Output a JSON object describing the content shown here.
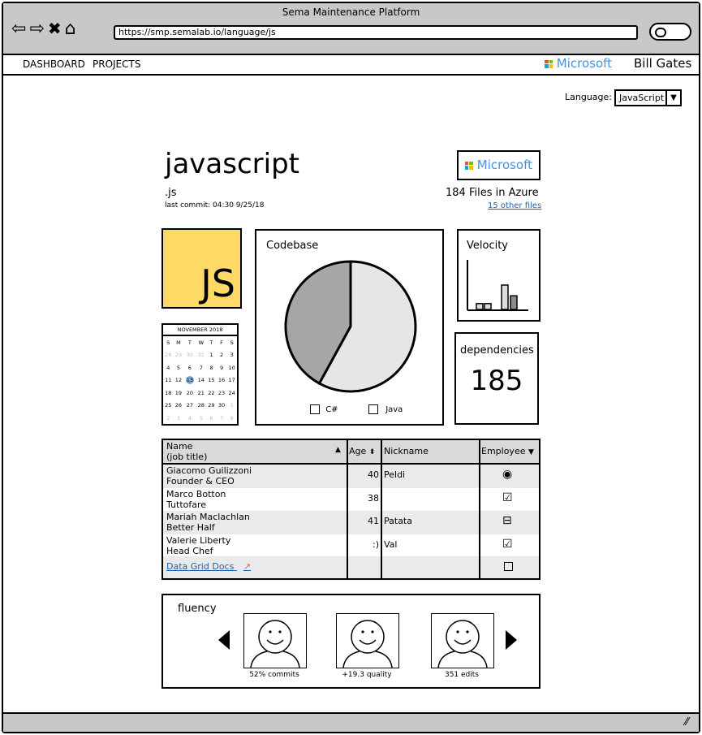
{
  "window": {
    "title": "Sema Maintenance Platform",
    "url": "https://smp.semalab.io/language/js"
  },
  "navbar": {
    "items": [
      "DASHBOARD",
      "PROJECTS"
    ],
    "org": "Microsoft",
    "user": "Bill Gates"
  },
  "language_select": {
    "label": "Language:",
    "value": "JavaScript"
  },
  "header": {
    "name": "javascript",
    "extension": ".js",
    "last_commit": "last commit: 04:30 9/25/18",
    "org_badge": "Microsoft",
    "files": "184 Files in Azure",
    "other_files": "15 other files"
  },
  "logo_text": "JS",
  "calendar": {
    "month": "NOVEMBER 2018",
    "weekdays": [
      "S",
      "M",
      "T",
      "W",
      "T",
      "F",
      "S"
    ],
    "weeks": [
      [
        "28",
        "29",
        "30",
        "31",
        "1",
        "2",
        "3"
      ],
      [
        "4",
        "5",
        "6",
        "7",
        "8",
        "9",
        "10"
      ],
      [
        "11",
        "12",
        "13",
        "14",
        "15",
        "16",
        "17"
      ],
      [
        "18",
        "19",
        "20",
        "21",
        "22",
        "23",
        "24"
      ],
      [
        "25",
        "26",
        "27",
        "28",
        "29",
        "30",
        "1"
      ],
      [
        "2",
        "3",
        "4",
        "5",
        "6",
        "7",
        "8"
      ]
    ],
    "selected": "13"
  },
  "codebase": {
    "title": "Codebase",
    "legend": [
      "C#",
      "Java"
    ],
    "slices": [
      {
        "label": "C#",
        "value": 42,
        "color": "#a6a6a6"
      },
      {
        "label": "Java",
        "value": 58,
        "color": "#e6e6e6"
      }
    ]
  },
  "velocity": {
    "title": "Velocity",
    "bars": [
      0.12,
      0.12,
      0.5,
      0.28
    ],
    "colors": [
      "#dcdcdc",
      "#dcdcdc",
      "#dcdcdc",
      "#8c8c8c"
    ]
  },
  "dependencies": {
    "title": "dependencies",
    "count": "185"
  },
  "grid": {
    "columns": {
      "name": "Name",
      "name_sub": "(job title)",
      "age": "Age",
      "nickname": "Nickname",
      "employee": "Employee"
    },
    "rows": [
      {
        "name": "Giacomo Guilizzoni",
        "title": "Founder & CEO",
        "age": "40",
        "nickname": "Peldi",
        "employee": "radio"
      },
      {
        "name": "Marco Botton",
        "title": "Tuttofare",
        "age": "38",
        "nickname": "",
        "employee": "checked"
      },
      {
        "name": "Mariah Maclachlan",
        "title": "Better Half",
        "age": "41",
        "nickname": "Patata",
        "employee": "partial"
      },
      {
        "name": "Valerie Liberty",
        "title": "Head Chef",
        "age": ":)",
        "nickname": "Val",
        "employee": "checked"
      }
    ],
    "footer_link": "Data Grid Docs"
  },
  "fluency": {
    "title": "fluency",
    "contributors": [
      {
        "caption": "52% commits"
      },
      {
        "caption": "+19.3 quality"
      },
      {
        "caption": "351 edits"
      }
    ]
  }
}
